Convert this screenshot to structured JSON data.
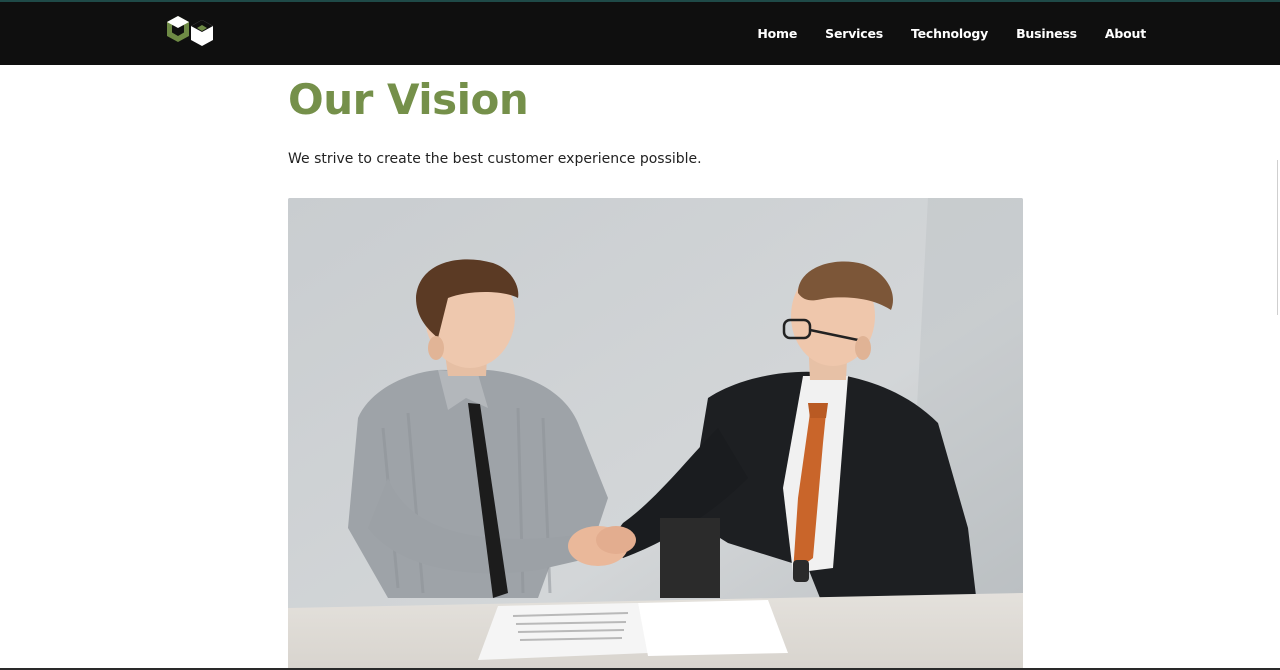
{
  "header": {
    "logo_name": "company-logo",
    "nav": [
      {
        "label": "Home"
      },
      {
        "label": "Services"
      },
      {
        "label": "Technology"
      },
      {
        "label": "Business"
      },
      {
        "label": "About"
      }
    ]
  },
  "main": {
    "title": "Our Vision",
    "intro": "We strive to create the best customer experience possible.",
    "image_subject": "two businessmen shaking hands at a table"
  },
  "colors": {
    "navbar": "#0f0f0f",
    "title": "#75904a",
    "logo_green": "#6e8a45"
  }
}
